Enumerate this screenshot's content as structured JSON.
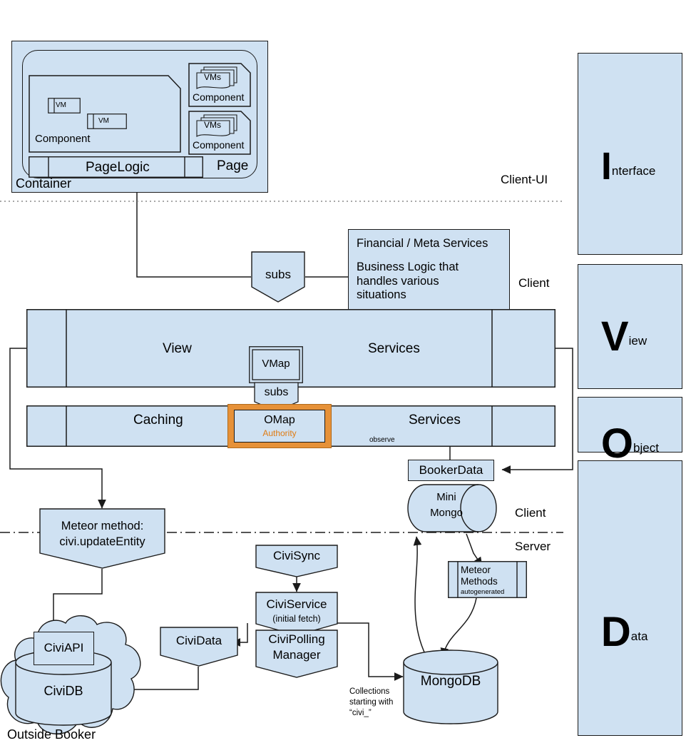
{
  "meta": {
    "title": "Client / Server Architecture — IVOD layers",
    "fill": "#cfe1f2",
    "stroke": "#1b1b1b",
    "accent": "#e69138",
    "background": "#ffffff"
  },
  "client_ui": {
    "container_label": "Container",
    "page_label": "Page",
    "pagelogic_label": "PageLogic",
    "component_left_label": "Component",
    "component_top_label": "Component",
    "component_bottom_label": "Component",
    "vm_1": "VM",
    "vm_2": "VM",
    "vms_top": "VMs",
    "vms_bottom": "VMs",
    "zone_label": "Client-UI"
  },
  "middle": {
    "subs_top": "subs",
    "subs_lower": "subs",
    "financial_title": "Financial / Meta Services",
    "financial_body": "Business Logic that\nhandles various\nsituations",
    "client_label": "Client",
    "view_label": "View",
    "services_upper_label": "Services",
    "vmap_label": "VMap",
    "caching_label": "Caching",
    "omap_label": "OMap",
    "omap_sub": "Authority",
    "services_lower_label": "Services",
    "observe_label": "observe",
    "bookerdata_label": "BookerData"
  },
  "data_layer": {
    "minimongo_label": "Mini\nMongo",
    "minimongo_line1": "Mini",
    "minimongo_line2": "Mongo",
    "client_label": "Client",
    "server_label": "Server",
    "meteor_methods_line1": "Meteor",
    "meteor_methods_line2": "Methods",
    "meteor_methods_sub": "autogenerated",
    "meteor_method_line1": "Meteor method:",
    "meteor_method_line2": "civi.updateEntity",
    "civisync_label": "CiviSync",
    "civiservice_label": "CiviService",
    "civiservice_sub": "(initial fetch)",
    "civipolling_line1": "CiviPolling",
    "civipolling_line2": "Manager",
    "cividata_label": "CiviData",
    "civiapi_label": "CiviAPI",
    "cividb_label": "CiviDB",
    "mongodb_label": "MongoDB",
    "outside_booker_label": "Outside Booker",
    "collections_note_line1": "Collections",
    "collections_note_line2": "starting with",
    "collections_note_line3": "“civi_”"
  },
  "legend": [
    {
      "initial": "I",
      "rest": "nterface"
    },
    {
      "initial": "V",
      "rest": "iew"
    },
    {
      "initial": "O",
      "rest": "bject"
    },
    {
      "initial": "D",
      "rest": "ata"
    }
  ]
}
